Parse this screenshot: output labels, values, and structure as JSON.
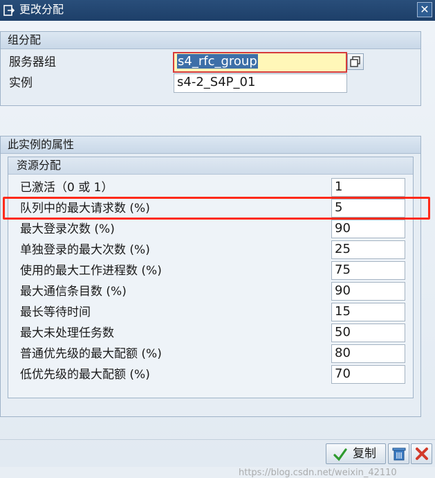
{
  "window": {
    "title": "更改分配",
    "title_icon": "edit-document-icon",
    "close_icon": "close-icon"
  },
  "group_assignment": {
    "title": "组分配",
    "server_group_label": "服务器组",
    "server_group_value": "s4_rfc_group",
    "instance_label": "实例",
    "instance_value": "s4-2_S4P_01",
    "value_help_icon": "copy-icon"
  },
  "instance_properties": {
    "title": "此实例的属性",
    "resource_allocation": {
      "title": "资源分配",
      "rows": [
        {
          "label": "已激活（0 或 1）",
          "value": "1"
        },
        {
          "label": "队列中的最大请求数 (%)",
          "value": "5"
        },
        {
          "label": "最大登录次数 (%)",
          "value": "90"
        },
        {
          "label": "单独登录的最大次数 (%)",
          "value": "25"
        },
        {
          "label": "使用的最大工作进程数 (%)",
          "value": "75"
        },
        {
          "label": "最大通信条目数 (%)",
          "value": "90"
        },
        {
          "label": "最长等待时间",
          "value": "15"
        },
        {
          "label": "最大未处理任务数",
          "value": "50"
        },
        {
          "label": "普通优先级的最大配额 (%)",
          "value": "80"
        },
        {
          "label": "低优先级的最大配额 (%)",
          "value": "70"
        }
      ]
    }
  },
  "footer": {
    "copy_label": "复制",
    "copy_icon": "checkmark-icon",
    "delete_icon": "trash-icon",
    "cancel_icon": "cancel-icon",
    "watermark": "https://blog.csdn.net/weixin_42110"
  },
  "colors": {
    "highlight": "#ff2a1a",
    "titlebar": "#1d3f69",
    "active_field": "#fff7b8"
  }
}
